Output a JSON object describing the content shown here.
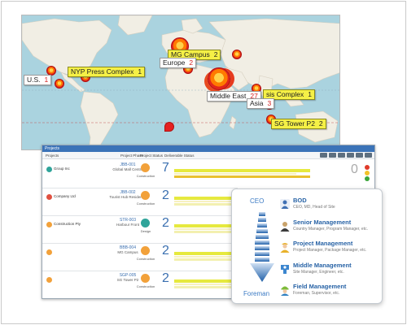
{
  "map": {
    "labels": [
      {
        "name": "U.S.",
        "count": "1",
        "highlight": false
      },
      {
        "name": "NYP Press Complex",
        "count": "1",
        "highlight": true
      },
      {
        "name": "MG Campus",
        "count": "2",
        "highlight": true
      },
      {
        "name": "Europe",
        "count": "2",
        "highlight": false
      },
      {
        "name": "Middle East",
        "count": "27",
        "highlight": false
      },
      {
        "name": "sis Complex",
        "count": "1",
        "highlight": true
      },
      {
        "name": "Asia",
        "count": "3",
        "highlight": false
      },
      {
        "name": "SG Tower P2",
        "count": "2",
        "highlight": true
      }
    ],
    "colors": {
      "water": "#aad3df",
      "land": "#f2efe6",
      "pin": "#e1261c",
      "label_highlight": "#f5f046"
    }
  },
  "projects": {
    "window_title": "Projects",
    "columns": [
      "Projects",
      "Project Phase",
      "Project Status",
      "Deliverable Status"
    ],
    "rows": [
      {
        "dot": "#2fa49a",
        "name": "Group Inc",
        "code": "JBB-001",
        "sub": "Global Mall Centre",
        "status_label": "Construction",
        "count": "7",
        "fill": 0.86,
        "status_color": "#f2a13a"
      },
      {
        "dot": "#e05040",
        "name": "Company Ltd",
        "code": "JBB-002",
        "sub": "Tourist Hub Residence",
        "status_label": "Construction",
        "count": "2",
        "fill": 0.58,
        "status_color": "#f2a13a"
      },
      {
        "dot": "#f2a13a",
        "name": "Construction Pty",
        "code": "STR-003",
        "sub": "Harbour Front",
        "status_label": "Design",
        "count": "2",
        "fill": 0.58,
        "status_color": "#2fa49a"
      },
      {
        "dot": "#f2a13a",
        "name": "",
        "code": "BBB-004",
        "sub": "MG Campus",
        "status_label": "Construction",
        "count": "2",
        "fill": 0.58,
        "status_color": "#f2a13a"
      },
      {
        "dot": "#f2a13a",
        "name": "",
        "code": "SGP-005",
        "sub": "SG Tower P2",
        "status_label": "Construction",
        "count": "2",
        "fill": 0.58,
        "status_color": "#f2a13a"
      }
    ],
    "side_count": "0",
    "side_badges": [
      "#e03b2a",
      "#f2c22a",
      "#3aa63a"
    ]
  },
  "org": {
    "top_label": "CEO",
    "bottom_label": "Foreman",
    "levels": [
      {
        "title": "BOD",
        "sub": "CEO, MD, Head of Site",
        "icon_color": "#3e6fb3"
      },
      {
        "title": "Senior Management",
        "sub": "Country Manager, Program Manager, etc.",
        "icon_color": "#c9a36b"
      },
      {
        "title": "Project Management",
        "sub": "Project Manager, Package Manager, etc.",
        "icon_color": "#e8b12a"
      },
      {
        "title": "Middle Management",
        "sub": "Site Manager, Engineer, etc.",
        "icon_color": "#3c86cf"
      },
      {
        "title": "Field Management",
        "sub": "Foreman, Supervisor, etc.",
        "icon_color": "#7dbb3a"
      }
    ]
  }
}
